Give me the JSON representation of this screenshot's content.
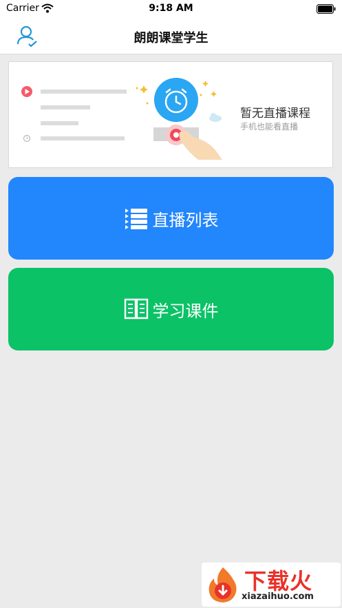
{
  "status_bar": {
    "carrier": "Carrier",
    "time": "9:18 AM"
  },
  "nav": {
    "title": "朗朗课堂学生",
    "user_icon": "user-check-icon"
  },
  "live_card": {
    "title": "暂无直播课程",
    "subtitle": "手机也能看直播"
  },
  "buttons": {
    "live_list": {
      "label": "直播列表",
      "icon": "list-icon",
      "color": "#2286fd"
    },
    "courseware": {
      "label": "学习课件",
      "icon": "book-icon",
      "color": "#0bc267"
    }
  },
  "watermark": {
    "main": "下载火",
    "sub": "xiazaihuo.com"
  },
  "colors": {
    "accent": "#2286fd",
    "green": "#0bc267",
    "background": "#ebebeb"
  }
}
